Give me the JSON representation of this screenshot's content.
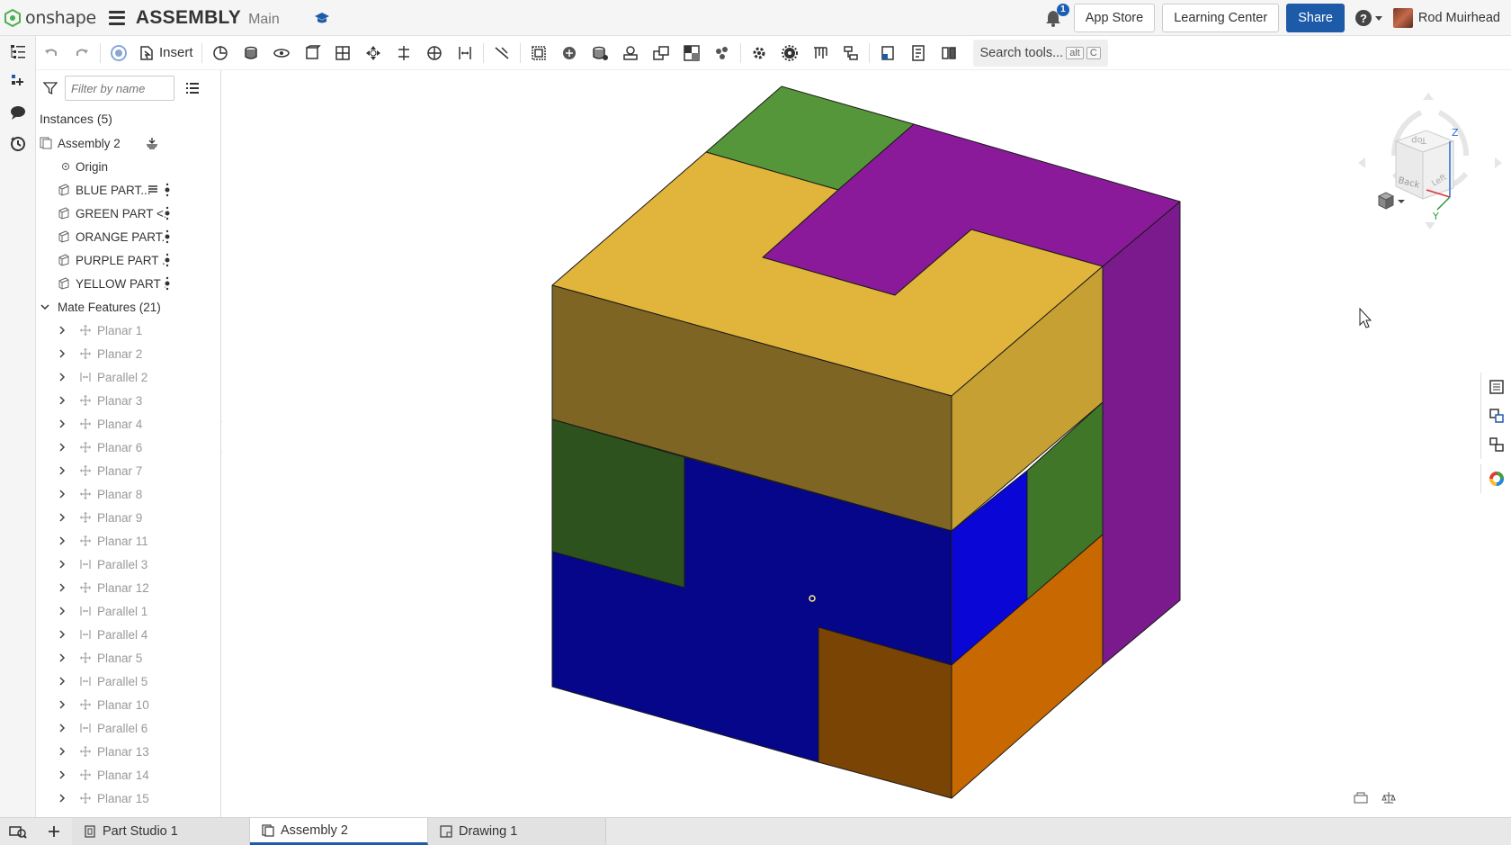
{
  "header": {
    "brand": "onshape",
    "doc_type": "ASSEMBLY",
    "branch": "Main",
    "notification_count": "1",
    "app_store": "App Store",
    "learning_center": "Learning Center",
    "share": "Share",
    "help": "?",
    "user": "Rod Muirhead"
  },
  "toolbar": {
    "insert": "Insert",
    "search": "Search tools...",
    "shortcut_alt": "alt",
    "shortcut_key": "C"
  },
  "panel": {
    "filter_placeholder": "Filter by name",
    "instances_title": "Instances (5)",
    "assembly": "Assembly 2",
    "origin": "Origin",
    "parts": [
      "BLUE PART...",
      "GREEN PART <...",
      "ORANGE PART...",
      "PURPLE PART ...",
      "YELLOW PART ..."
    ],
    "mates_title": "Mate Features (21)",
    "mates": [
      {
        "label": "Planar 1",
        "kind": "planar"
      },
      {
        "label": "Planar 2",
        "kind": "planar"
      },
      {
        "label": "Parallel 2",
        "kind": "parallel"
      },
      {
        "label": "Planar 3",
        "kind": "planar"
      },
      {
        "label": "Planar 4",
        "kind": "planar"
      },
      {
        "label": "Planar 6",
        "kind": "planar"
      },
      {
        "label": "Planar 7",
        "kind": "planar"
      },
      {
        "label": "Planar 8",
        "kind": "planar"
      },
      {
        "label": "Planar 9",
        "kind": "planar"
      },
      {
        "label": "Planar 11",
        "kind": "planar"
      },
      {
        "label": "Parallel 3",
        "kind": "parallel"
      },
      {
        "label": "Planar 12",
        "kind": "planar"
      },
      {
        "label": "Parallel 1",
        "kind": "parallel"
      },
      {
        "label": "Parallel 4",
        "kind": "parallel"
      },
      {
        "label": "Planar 5",
        "kind": "planar"
      },
      {
        "label": "Parallel 5",
        "kind": "parallel"
      },
      {
        "label": "Planar 10",
        "kind": "planar"
      },
      {
        "label": "Parallel 6",
        "kind": "parallel"
      },
      {
        "label": "Planar 13",
        "kind": "planar"
      },
      {
        "label": "Planar 14",
        "kind": "planar"
      },
      {
        "label": "Planar 15",
        "kind": "planar"
      }
    ]
  },
  "view_cube": {
    "top": "Top",
    "back": "Back",
    "left": "Left",
    "axis_z": "Z",
    "axis_y": "Y"
  },
  "tabs": [
    "Part Studio 1",
    "Assembly 2",
    "Drawing 1"
  ],
  "active_tab": "Assembly 2",
  "colors": {
    "yellow_top": "#e1b43b",
    "yellow_front": "#7f6524",
    "yellow_side": "#c7a034",
    "purple_top": "#8b1a9b",
    "purple_side": "#7a1a8c",
    "green_top": "#55963a",
    "green_front": "#2d521e",
    "green_side": "#3f7628",
    "blue_front": "#05068a",
    "blue_side": "#0a06d6",
    "orange_front": "#7a4405",
    "orange_side": "#c86800",
    "accent": "#1d5ba9"
  }
}
